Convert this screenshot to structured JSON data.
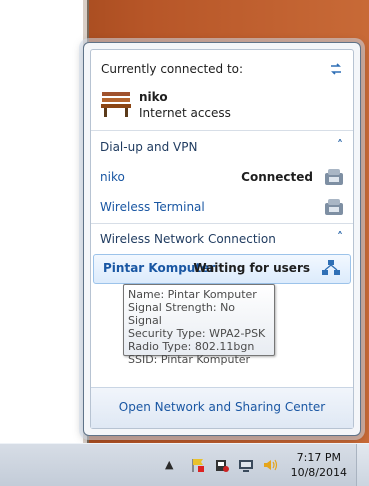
{
  "flyout": {
    "currently_connected_label": "Currently connected to:",
    "current_connection": {
      "name": "niko",
      "access": "Internet access"
    },
    "groups": [
      {
        "title": "Dial-up and VPN",
        "items": [
          {
            "name": "niko",
            "status": "Connected"
          },
          {
            "name": "Wireless Terminal",
            "status": ""
          }
        ]
      },
      {
        "title": "Wireless Network Connection",
        "items": [
          {
            "name": "Pintar Komputer",
            "status": "Waiting for users"
          }
        ]
      }
    ],
    "tooltip": {
      "name": "Name: Pintar Komputer",
      "signal": "Signal Strength: No Signal",
      "security": "Security Type: WPA2-PSK",
      "radio": "Radio Type: 802.11bgn",
      "ssid": "SSID: Pintar Komputer"
    },
    "footer_link": "Open Network and Sharing Center"
  },
  "taskbar": {
    "time": "7:17 PM",
    "date": "10/8/2014",
    "icons": [
      "show-hidden-icons-arrow",
      "action-center-flag-icon",
      "safely-remove-hardware-icon",
      "network-icon",
      "volume-icon"
    ]
  },
  "colors": {
    "link": "#1a57a3",
    "selection": "#dcebfc"
  }
}
